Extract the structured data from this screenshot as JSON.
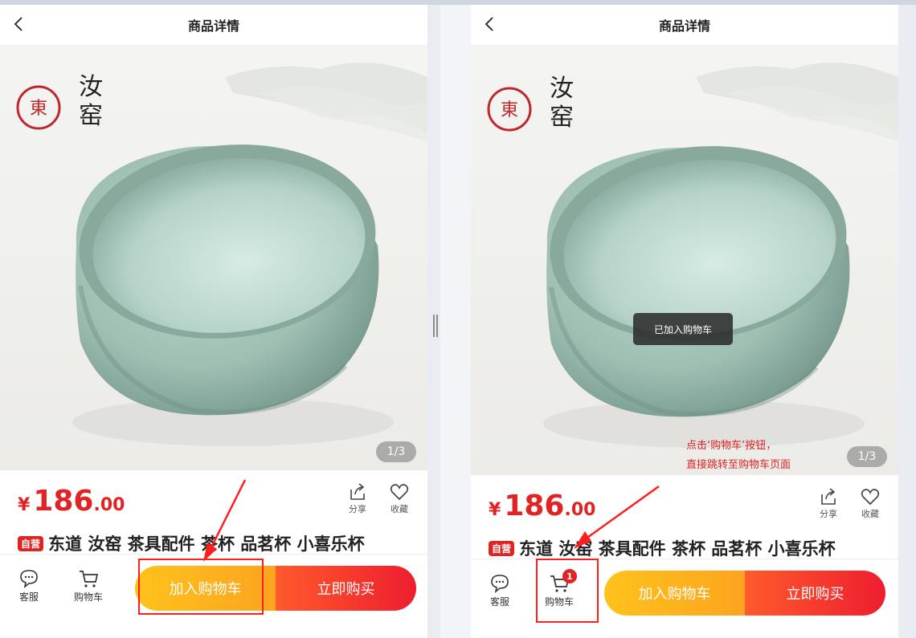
{
  "colors": {
    "accent_red": "#e02424",
    "cart_btn": "#fdb81d",
    "buy_btn": "#f22e2e",
    "highlight": "#ff1e1e",
    "glaze": "#a9c8bd"
  },
  "left": {
    "navbar": {
      "title": "商品详情",
      "back_icon": "chevron-left-icon"
    },
    "gallery": {
      "pager": "1/3",
      "logo_text": "東道汝窑"
    },
    "info": {
      "price_symbol": "¥",
      "price_int": "186",
      "price_dec": ".00",
      "share_label": "分享",
      "fav_label": "收藏",
      "tag": "自营",
      "title": "东道 汝窑 茶具配件 茶杯 品茗杯 小喜乐杯"
    },
    "bottom": {
      "service_label": "客服",
      "cart_label": "购物车",
      "add_cart": "加入购物车",
      "buy_now": "立即购买"
    }
  },
  "right": {
    "navbar": {
      "title": "商品详情",
      "back_icon": "chevron-left-icon"
    },
    "gallery": {
      "pager": "1/3",
      "logo_text": "東道汝窑"
    },
    "toast": "已加入购物车",
    "annotation": {
      "line1": "点击‘购物车’按钮，",
      "line2": "直接跳转至购物车页面"
    },
    "info": {
      "price_symbol": "¥",
      "price_int": "186",
      "price_dec": ".00",
      "share_label": "分享",
      "fav_label": "收藏",
      "tag": "自营",
      "title": "东道 汝窑 茶具配件 茶杯 品茗杯 小喜乐杯"
    },
    "bottom": {
      "service_label": "客服",
      "cart_label": "购物车",
      "cart_badge": "1",
      "add_cart": "加入购物车",
      "buy_now": "立即购买"
    }
  }
}
